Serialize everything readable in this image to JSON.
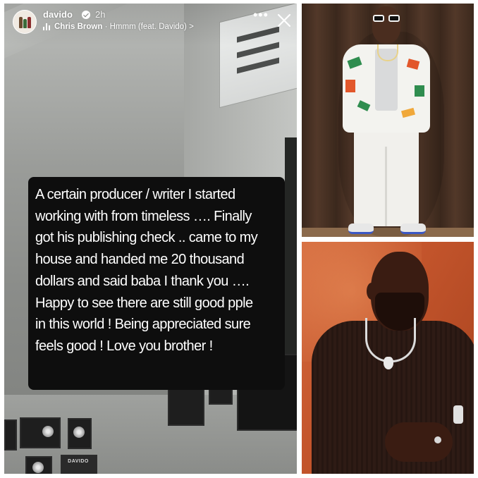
{
  "story": {
    "username": "davido",
    "time": "2h",
    "music": {
      "artist": "Chris Brown",
      "separator": " · ",
      "song": "Hmmm (feat. Davido)",
      "chevron": ">"
    },
    "more_glyph": "•••",
    "caption_lines": [
      "A certain producer / writer I started",
      "working with from timeless …. Finally",
      "got his publishing check .. came to my",
      "house and handed me 20 thousand",
      "dollars and said baba I thank you ….",
      "Happy to see there are still good pple",
      "in this world ! Being appreciated sure",
      "feels good ! Love you brother !"
    ],
    "plaque_text": "DAVIDO"
  },
  "icons": {
    "verified": "verified-badge-icon",
    "music": "music-bars-icon",
    "more": "more-options-icon",
    "close": "close-icon"
  },
  "colors": {
    "caption_bg": "#0e0e0e",
    "caption_text": "#ffffff",
    "story_text": "#ffffff",
    "photo2_bg": "#c4552c"
  }
}
